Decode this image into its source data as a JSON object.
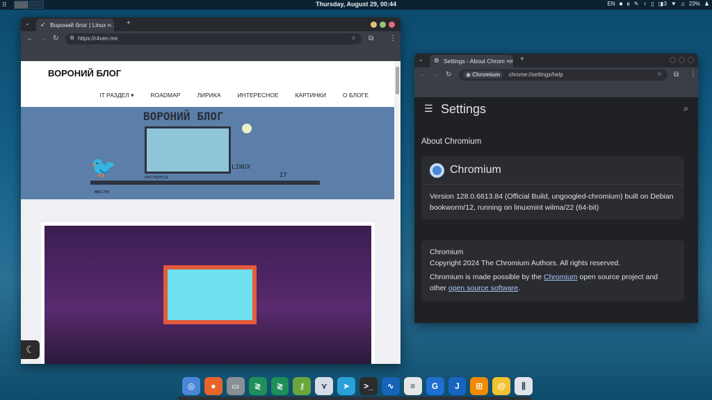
{
  "panel": {
    "clock": "Thursday, August 29, 00:44",
    "lang": "EN",
    "notifications": "3",
    "battery": "23%",
    "menu_icon": "grid-icon"
  },
  "blog_window": {
    "tab_title": "Вороний блог | Linux и ...",
    "url": "https://r4ven.me",
    "site_title": "ВОРОНИЙ БЛОГ",
    "nav": [
      "IT РАЗДЕЛ",
      "ROADMAP",
      "ЛИРИКА",
      "ИНТЕРЕСНОЕ",
      "КАРТИНКИ",
      "О БЛОГЕ"
    ],
    "banner": {
      "title": "ВОРОНИЙ БЛОГ",
      "labels": [
        "LINUX",
        "IT",
        "интересы",
        "мысли"
      ]
    }
  },
  "settings_window": {
    "tab_title": "Settings - About Chromium",
    "chip": "Chromium",
    "url": "chrome://settings/help",
    "header": "Settings",
    "section": "About Chromium",
    "product": "Chromium",
    "version": "Version 128.0.6613.84 (Official Build, ungoogled-chromium) built on Debian bookworm/12, running on linuxmint wilma/22 (64-bit)",
    "info_name": "Chromium",
    "copyright": "Copyright 2024 The Chromium Authors. All rights reserved.",
    "made_prefix": "Chromium is made possible by the ",
    "made_link": "Chromium",
    "made_mid": " open source project and other ",
    "made_link2": "open source software",
    "made_suffix": "."
  },
  "dock": [
    {
      "name": "chromium",
      "color": "#4a86d8",
      "glyph": "◎"
    },
    {
      "name": "firefox",
      "color": "#e8652a",
      "glyph": "●"
    },
    {
      "name": "files",
      "color": "#8a8f96",
      "glyph": "▭"
    },
    {
      "name": "remmina",
      "color": "#1f8f58",
      "glyph": "≷"
    },
    {
      "name": "remmina-2",
      "color": "#1f8f58",
      "glyph": "≷"
    },
    {
      "name": "keepass",
      "color": "#6aa63a",
      "glyph": "⚷"
    },
    {
      "name": "vscodium",
      "color": "#d6dde6",
      "glyph": "⋎"
    },
    {
      "name": "telegram",
      "color": "#2aa0d8",
      "glyph": "➤"
    },
    {
      "name": "terminal",
      "color": "#2b2b2b",
      "glyph": ">_"
    },
    {
      "name": "system-monitor",
      "color": "#1763b8",
      "glyph": "∿"
    },
    {
      "name": "text-editor",
      "color": "#e6e6e6",
      "glyph": "≡"
    },
    {
      "name": "gparted",
      "color": "#1f6fd0",
      "glyph": "G"
    },
    {
      "name": "joplin",
      "color": "#1565c0",
      "glyph": "J"
    },
    {
      "name": "diagram",
      "color": "#f08a00",
      "glyph": "⊞"
    },
    {
      "name": "mail",
      "color": "#f2c230",
      "glyph": "@"
    },
    {
      "name": "mixer",
      "color": "#e0e4ea",
      "glyph": "⫼"
    }
  ]
}
